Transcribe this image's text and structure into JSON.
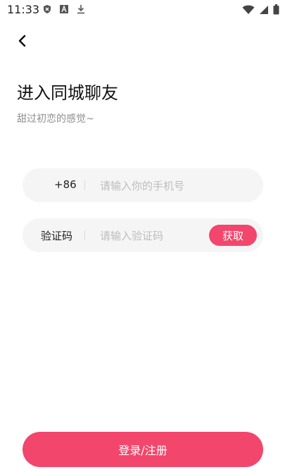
{
  "status_bar": {
    "time": "11:33",
    "icons_left": [
      "shield-x-icon",
      "text-a-icon",
      "download-icon"
    ],
    "icons_right": [
      "wifi-icon",
      "cellular-signal-icon",
      "battery-icon"
    ]
  },
  "header": {
    "back_icon": "chevron-left-icon"
  },
  "main": {
    "title": "进入同城聊友",
    "subtitle": "甜过初恋的感觉~"
  },
  "phone_field": {
    "label": "+86",
    "placeholder": "请输入你的手机号",
    "value": ""
  },
  "code_field": {
    "label": "验证码",
    "placeholder": "请输入验证码",
    "value": "",
    "get_code_label": "获取"
  },
  "actions": {
    "login_label": "登录/注册"
  },
  "colors": {
    "accent": "#f2466c",
    "field_bg": "#f5f5f5",
    "placeholder": "#bdbdbd",
    "subtitle": "#8f8f8f"
  }
}
